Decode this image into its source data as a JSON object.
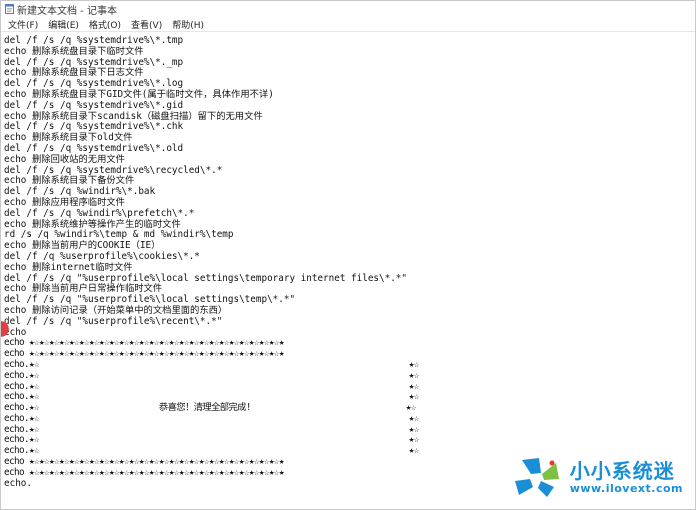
{
  "window": {
    "title": "新建文本文档 - 记事本"
  },
  "menu": {
    "items": [
      "文件(F)",
      "编辑(E)",
      "格式(O)",
      "查看(V)",
      "帮助(H)"
    ]
  },
  "editor": {
    "lines": [
      "del /f /s /q %systemdrive%\\*.tmp",
      "echo 删除系统盘目录下临时文件",
      "del /f /s /q %systemdrive%\\*._mp",
      "echo 删除系统盘目录下日志文件",
      "del /f /s /q %systemdrive%\\*.log",
      "echo 删除系统盘目录下GID文件(属于临时文件，具体作用不详)",
      "del /f /s /q %systemdrive%\\*.gid",
      "echo 删除系统目录下scandisk（磁盘扫描）留下的无用文件",
      "del /f /s /q %systemdrive%\\*.chk",
      "echo 删除系统目录下old文件",
      "del /f /s /q %systemdrive%\\*.old",
      "echo 删除回收站的无用文件",
      "del /f /s /q %systemdrive%\\recycled\\*.*",
      "echo 删除系统目录下备份文件",
      "del /f /s /q %windir%\\*.bak",
      "echo 删除应用程序临时文件",
      "del /f /s /q %windir%\\prefetch\\*.*",
      "echo 删除系统维护等操作产生的临时文件",
      "rd /s /q %windir%\\temp & md %windir%\\temp",
      "echo 删除当前用户的COOKIE（IE）",
      "del /f /q %userprofile%\\cookies\\*.*",
      "echo 删除internet临时文件",
      "del /f /s /q \"%userprofile%\\local settings\\temporary internet files\\*.*\"",
      "echo 删除当前用户日常操作临时文件",
      "del /f /s /q \"%userprofile%\\local settings\\temp\\*.*\"",
      "echo 删除访问记录（开始菜单中的文档里面的东西）",
      "del /f /s /q \"%userprofile%\\recent\\*.*\"",
      "echo",
      "echo ★☆★☆★☆★☆★☆★☆★☆★☆★☆★☆★☆★☆★☆★☆★☆★☆★☆★☆★☆★☆★☆★☆★☆★☆★☆★",
      "echo ★☆★☆★☆★☆★☆★☆★☆★☆★☆★☆★☆★☆★☆★☆★☆★☆★☆★☆★☆★☆★☆★☆★☆★☆★☆★",
      "echo.★☆                                                                          ★☆",
      "echo.★☆                                                                          ★☆",
      "echo.★☆                                                                          ★☆",
      "echo.★☆                                                                          ★☆",
      "echo.★☆                        恭喜您！清理全部完成!                               ★☆",
      "echo.★☆                                                                          ★☆",
      "echo.★☆                                                                          ★☆",
      "echo.★☆                                                                          ★☆",
      "echo.★☆                                                                          ★☆",
      "echo ★☆★☆★☆★☆★☆★☆★☆★☆★☆★☆★☆★☆★☆★☆★☆★☆★☆★☆★☆★☆★☆★☆★☆★☆★☆★",
      "echo ★☆★☆★☆★☆★☆★☆★☆★☆★☆★☆★☆★☆★☆★☆★☆★☆★☆★☆★☆★☆★☆★☆★☆★☆★☆★",
      "echo."
    ]
  },
  "watermark": {
    "title": "小小系统迷",
    "url": "www.ilovext.com",
    "colors": {
      "blue": "#1a8fd8",
      "green": "#7cc142",
      "red": "#e3382f"
    }
  }
}
